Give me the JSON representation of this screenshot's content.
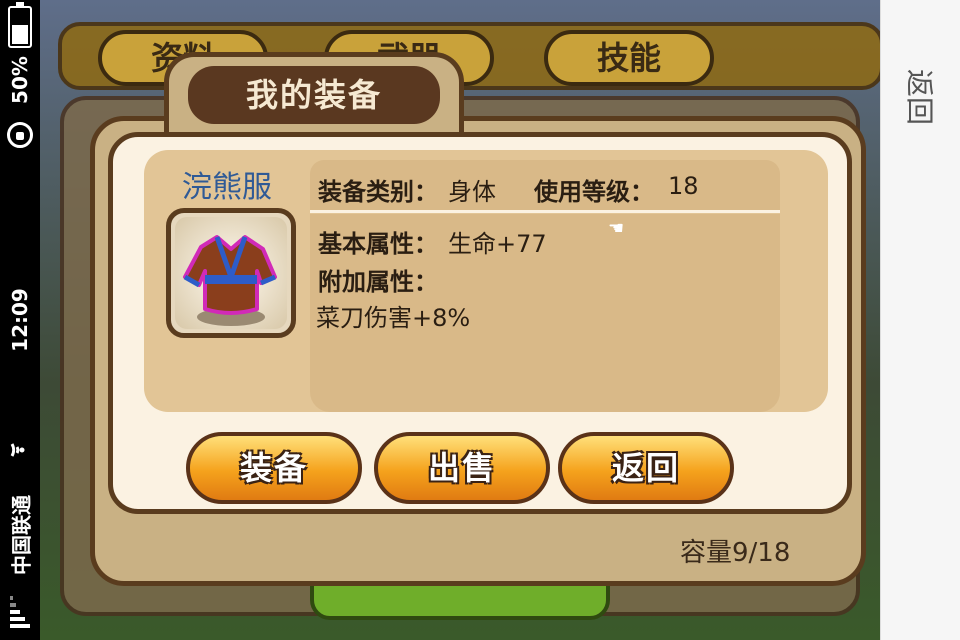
{
  "status_bar": {
    "battery_percent": "50%",
    "time": "12:09",
    "carrier": "中国联通"
  },
  "side_panel": {
    "back_label": "返回"
  },
  "background": {
    "tabs": [
      "资料",
      "武器",
      "技能"
    ],
    "back_button_label": "返回"
  },
  "dialog": {
    "title": "我的装备",
    "capacity": "容量9/18",
    "item": {
      "name": "浣熊服",
      "category_label": "装备类别：",
      "category_value": "身体",
      "level_label": "使用等级：",
      "level_value": "18",
      "base_attr_label": "基本属性：",
      "base_attr_value": "生命+77",
      "extra_attr_label": "附加属性：",
      "extra_attr_value": "菜刀伤害+8%"
    },
    "buttons": {
      "equip": "装备",
      "sell": "出售",
      "back": "返回"
    }
  },
  "colors": {
    "item_name": "#2f5a96",
    "button_fill": "#f5a21c",
    "dialog_border": "#5a3c1e"
  }
}
